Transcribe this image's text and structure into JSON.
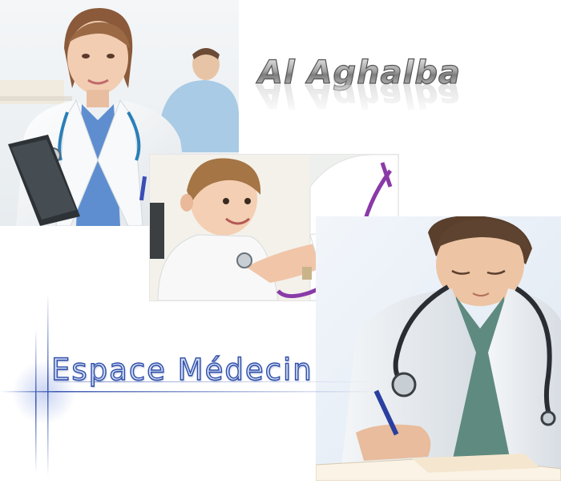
{
  "logo": {
    "text": "Al Aghalba"
  },
  "section": {
    "title": "Espace Médecin"
  },
  "colors": {
    "logo_fill": "#9a9a9a",
    "title_stroke": "#2f4fa8",
    "title_fill": "#cfd9f3",
    "accent_line": "#3a56b0"
  },
  "images": {
    "top_left": "doctor-woman-with-stethoscope-and-clipboard",
    "center": "doctor-examining-child-with-stethoscope",
    "bottom_right": "doctor-man-writing-with-stethoscope"
  }
}
